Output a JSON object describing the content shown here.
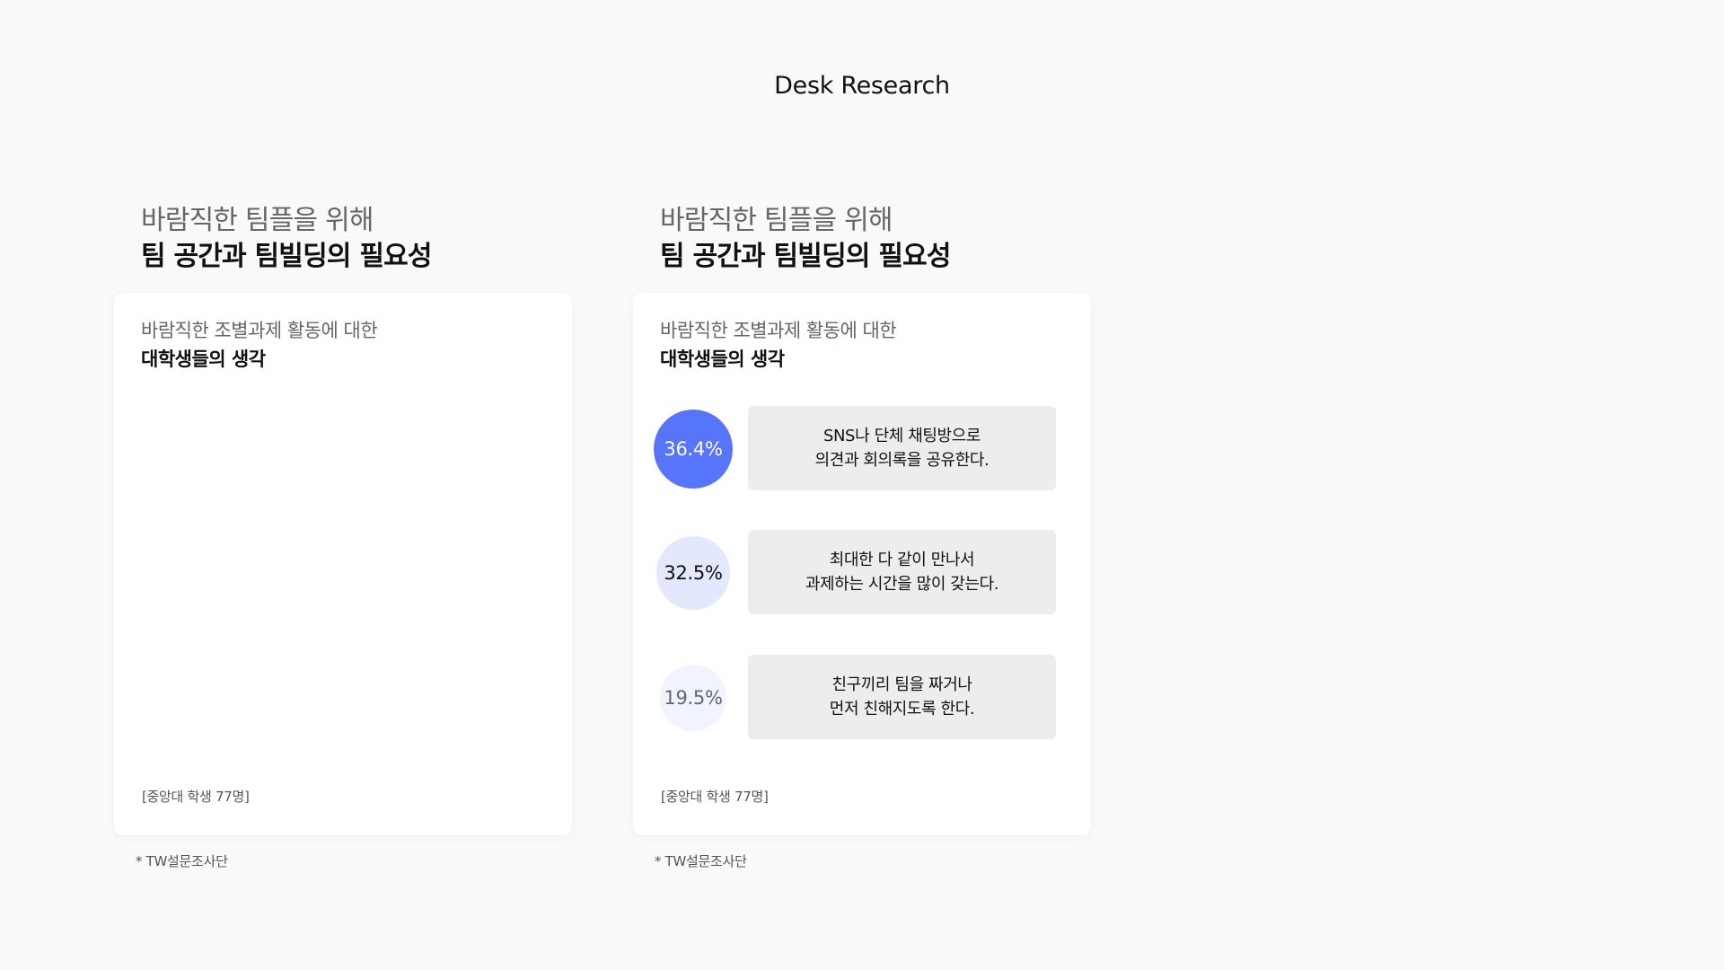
{
  "page": {
    "title": "Desk Research"
  },
  "panels": [
    {
      "heading_line1": "바람직한 팀플을 위해",
      "heading_line2": "팀 공간과 팀빌딩의 필요성",
      "card_title_line1": "바람직한 조별과제 활동에 대한",
      "card_title_line2": "대학생들의 생각",
      "card_note": "[중앙대 학생 77명]",
      "source": "* TW설문조사단"
    },
    {
      "heading_line1": "바람직한 팀플을 위해",
      "heading_line2": "팀 공간과 팀빌딩의 필요성",
      "card_title_line1": "바람직한 조별과제 활동에 대한",
      "card_title_line2": "대학생들의 생각",
      "card_note": "[중앙대 학생 77명]",
      "source": "* TW설문조사단",
      "stats": [
        {
          "percent": "36.4%",
          "line1": "SNS나 단체 채팅방으로",
          "line2": "의견과 회의록을 공유한다.",
          "color": "#5775fb"
        },
        {
          "percent": "32.5%",
          "line1": "최대한 다 같이 만나서",
          "line2": "과제하는 시간을 많이 갖는다.",
          "color": "#e3e8fd"
        },
        {
          "percent": "19.5%",
          "line1": "친구끼리 팀을 짜거나",
          "line2": "먼저 친해지도록 한다.",
          "color": "#f1f4fe"
        }
      ]
    }
  ]
}
